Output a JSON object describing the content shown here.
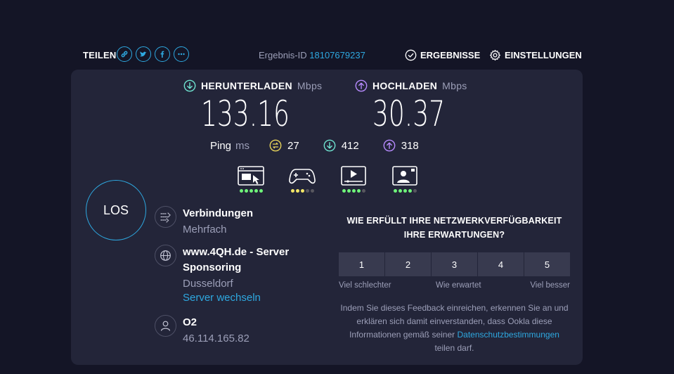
{
  "header": {
    "share_label": "TEILEN",
    "share_icons": [
      "link-icon",
      "twitter-icon",
      "facebook-icon",
      "more-icon"
    ],
    "result_id_label": "Ergebnis-ID",
    "result_id": "18107679237",
    "results_label": "ERGEBNISSE",
    "settings_label": "EINSTELLUNGEN"
  },
  "download": {
    "label": "HERUNTERLADEN",
    "unit": "Mbps",
    "value": "133.16"
  },
  "upload": {
    "label": "HOCHLADEN",
    "unit": "Mbps",
    "value": "30.37"
  },
  "ping": {
    "label": "Ping",
    "unit": "ms",
    "idle": "27",
    "download": "412",
    "upload": "318"
  },
  "apps": [
    {
      "name": "web-browsing-icon",
      "rating": 5,
      "color": "green"
    },
    {
      "name": "gaming-icon",
      "rating": 3,
      "color": "yellow"
    },
    {
      "name": "video-streaming-icon",
      "rating": 4,
      "color": "green"
    },
    {
      "name": "video-chat-icon",
      "rating": 4,
      "color": "green"
    }
  ],
  "go_button": "LOS",
  "connections": {
    "title": "Verbindungen",
    "value": "Mehrfach"
  },
  "server": {
    "title": "www.4QH.de - Server Sponsoring",
    "location": "Dusseldorf",
    "change_link": "Server wechseln"
  },
  "provider": {
    "title": "O2",
    "ip": "46.114.165.82"
  },
  "feedback": {
    "question": "WIE ERFÜLLT IHRE NETZWERKVERFÜGBARKEIT IHRE ERWARTUNGEN?",
    "ratings": [
      "1",
      "2",
      "3",
      "4",
      "5"
    ],
    "label_low": "Viel schlechter",
    "label_mid": "Wie erwartet",
    "label_high": "Viel besser",
    "note": "Indem Sie dieses Feedback einreichen, erkennen Sie an und erklären sich damit einverstanden, dass Ookla diese Informationen gemäß seiner",
    "privacy_link": "Datenschutzbestimmungen",
    "note_end": "teilen darf."
  },
  "colors": {
    "background": "#141526",
    "panel": "#232539",
    "accent": "#2ea8e0",
    "download": "#6fe3d0",
    "upload": "#b78bff",
    "ping": "#e8d45a"
  }
}
